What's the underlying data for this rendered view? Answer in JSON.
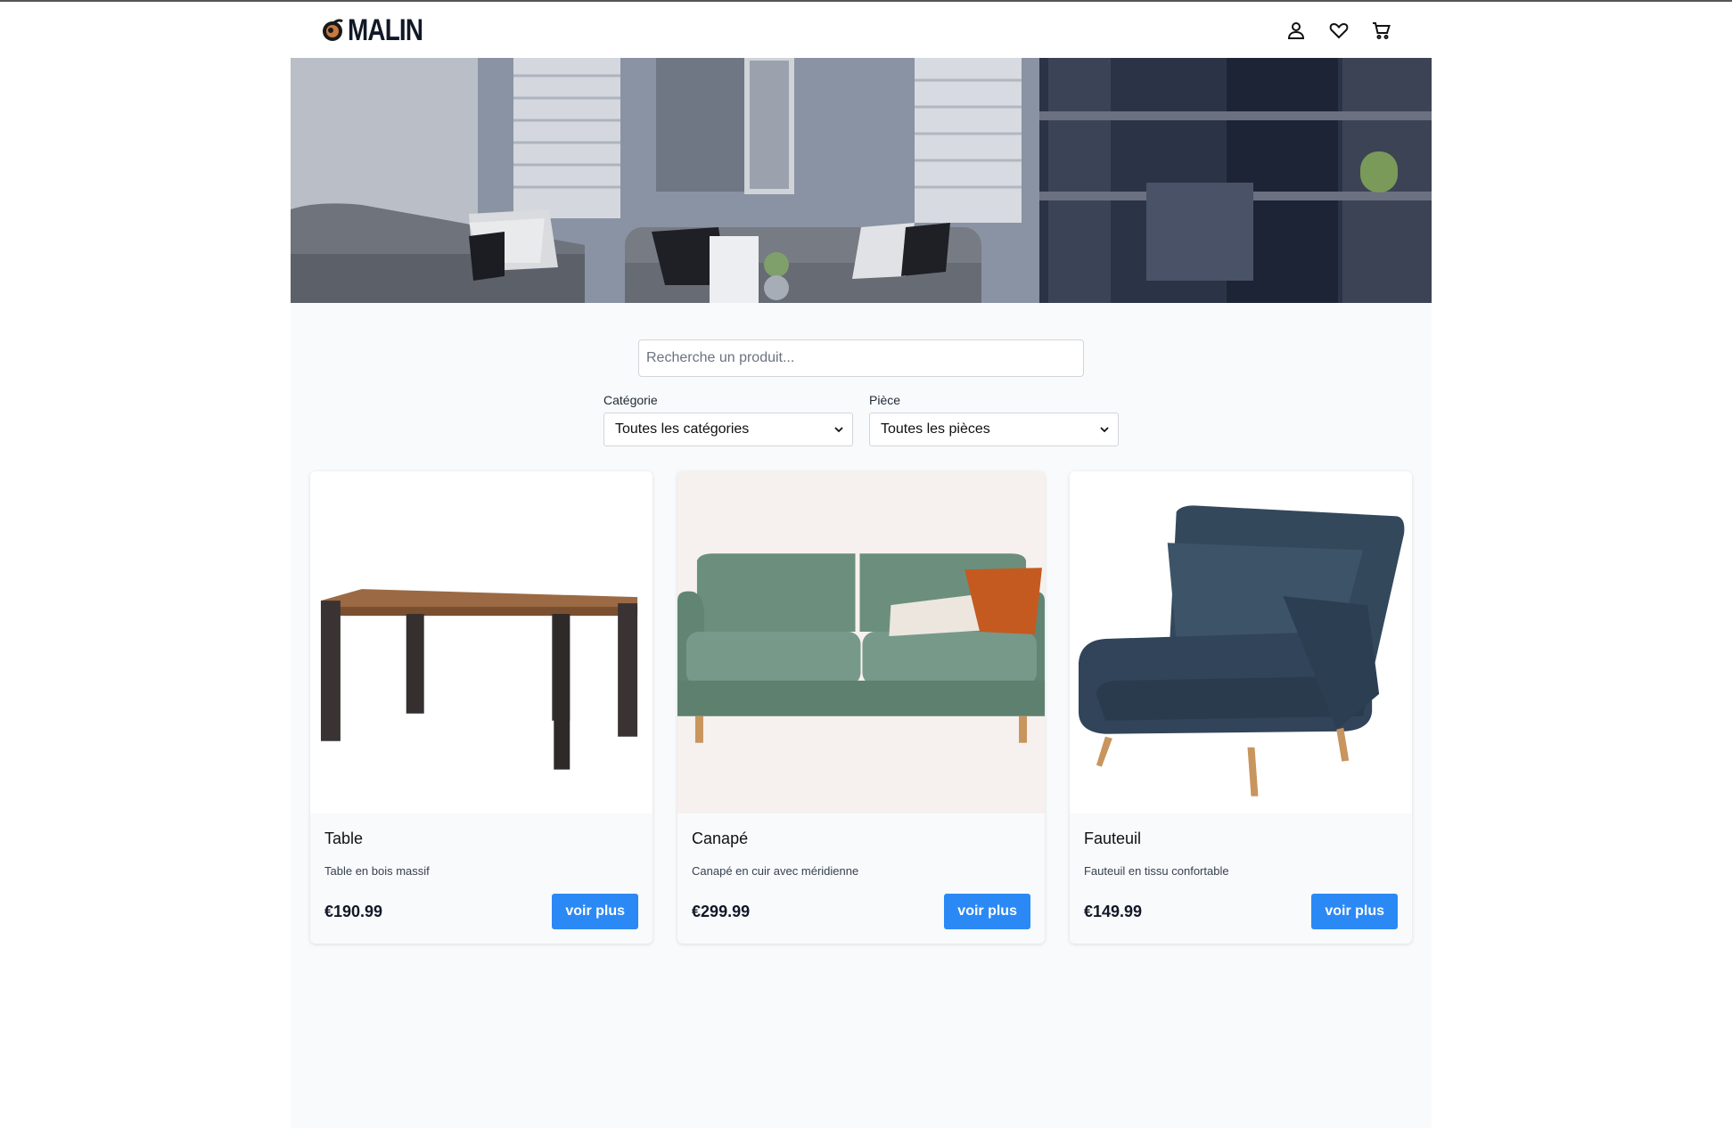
{
  "brand": {
    "name": "MALIN"
  },
  "header": {
    "icons": [
      "user-icon",
      "heart-icon",
      "cart-icon"
    ]
  },
  "search": {
    "placeholder": "Recherche un produit..."
  },
  "filters": {
    "category": {
      "label": "Catégorie",
      "value": "Toutes les catégories"
    },
    "room": {
      "label": "Pièce",
      "value": "Toutes les pièces"
    }
  },
  "products": [
    {
      "name": "Table",
      "description": "Table en bois massif",
      "price": "€190.99",
      "button": "voir plus"
    },
    {
      "name": "Canapé",
      "description": "Canapé en cuir avec méridienne",
      "price": "€299.99",
      "button": "voir plus"
    },
    {
      "name": "Fauteuil",
      "description": "Fauteuil en tissu confortable",
      "price": "€149.99",
      "button": "voir plus"
    }
  ],
  "colors": {
    "accent": "#2b89f5",
    "background": "#f9fafb"
  }
}
